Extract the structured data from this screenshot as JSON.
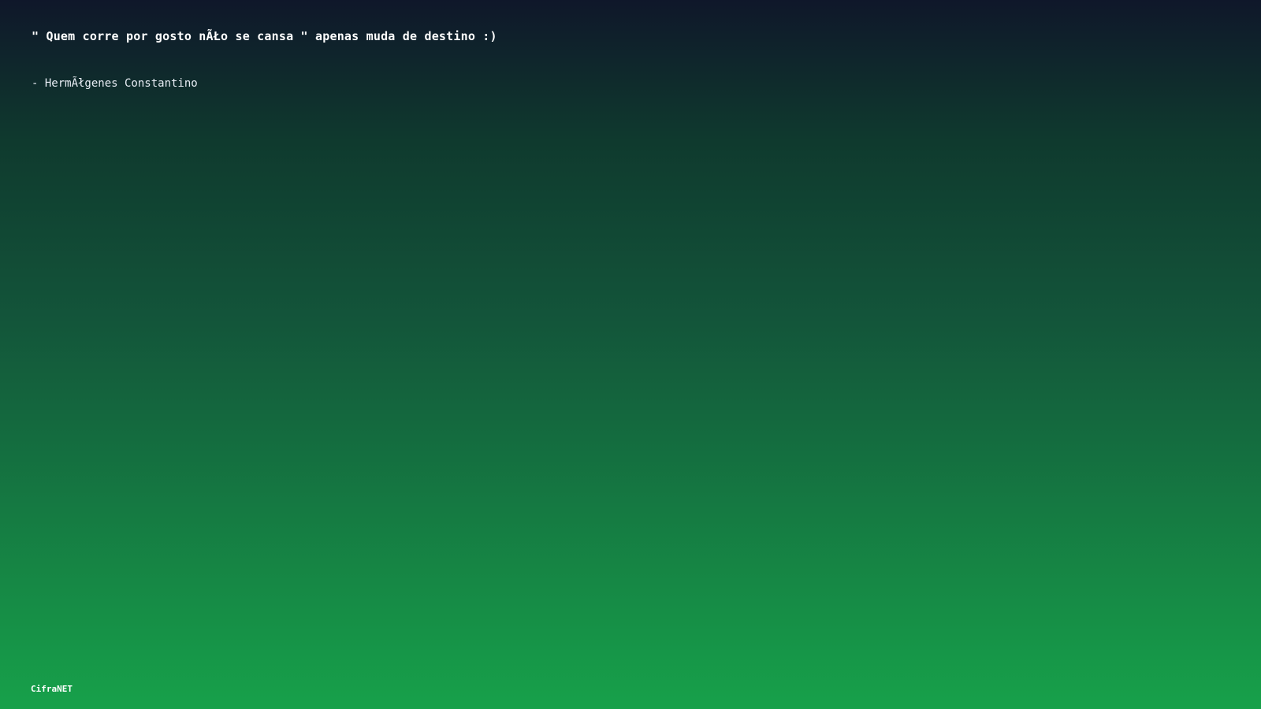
{
  "quote": {
    "text": "\" Quem corre por gosto nÃŁo se cansa \" apenas muda de destino :)",
    "author": "- HermÃłgenes Constantino"
  },
  "brand": {
    "name": "CifraNET"
  },
  "theme": {
    "gradient_top": "#0f172a",
    "gradient_bottom": "#17a14a",
    "text_color": "#ffffff"
  }
}
